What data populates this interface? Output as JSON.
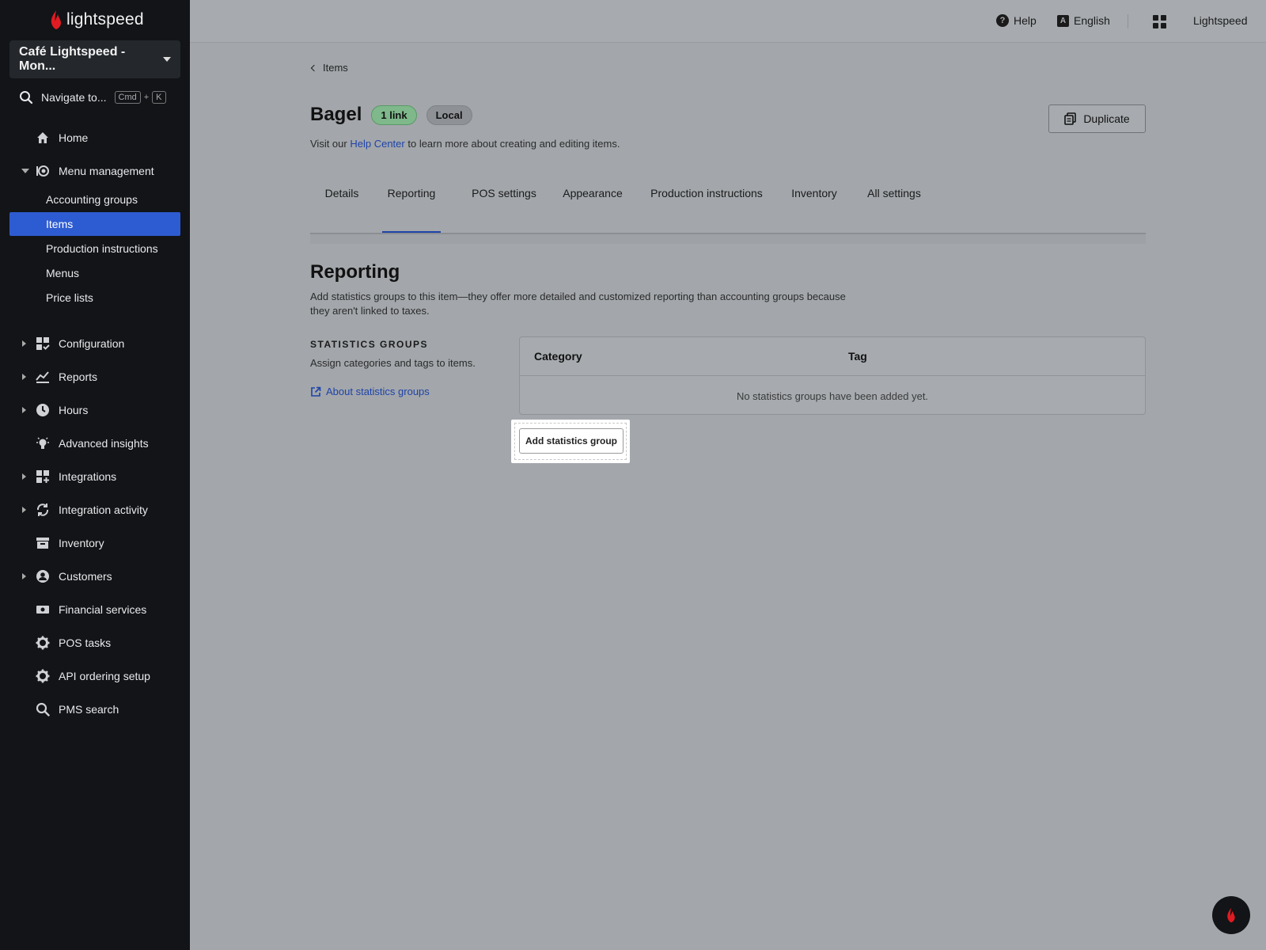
{
  "app": {
    "logo_text": "lightspeed",
    "location": "Café Lightspeed - Mon..."
  },
  "navigate": {
    "label": "Navigate to...",
    "key1": "Cmd",
    "plus": "+",
    "key2": "K"
  },
  "sidebar": {
    "home": "Home",
    "menu_management": "Menu management",
    "submenu": [
      "Accounting groups",
      "Items",
      "Production instructions",
      "Menus",
      "Price lists"
    ],
    "items": [
      {
        "label": "Configuration",
        "icon": "configuration-icon"
      },
      {
        "label": "Reports",
        "icon": "reports-icon"
      },
      {
        "label": "Hours",
        "icon": "clock-icon"
      },
      {
        "label": "Advanced insights",
        "icon": "lightbulb-icon"
      },
      {
        "label": "Integrations",
        "icon": "integrations-icon"
      },
      {
        "label": "Integration activity",
        "icon": "sync-icon"
      },
      {
        "label": "Inventory",
        "icon": "inventory-icon"
      },
      {
        "label": "Customers",
        "icon": "customer-icon"
      },
      {
        "label": "Financial services",
        "icon": "cash-icon"
      },
      {
        "label": "POS tasks",
        "icon": "gear-icon"
      },
      {
        "label": "API ordering setup",
        "icon": "gear-icon"
      },
      {
        "label": "PMS search",
        "icon": "search-icon"
      }
    ]
  },
  "topbar": {
    "help": "Help",
    "language_icon": "A",
    "language": "English",
    "account": "Lightspeed"
  },
  "page": {
    "breadcrumb": "Items",
    "title": "Bagel",
    "badge_link": "1 link",
    "badge_local": "Local",
    "help_prefix": "Visit our",
    "help_link": "Help Center",
    "help_suffix": "to learn more about creating and editing items.",
    "duplicate": "Duplicate"
  },
  "tabs": [
    "Details",
    "Reporting",
    "POS settings",
    "Appearance",
    "Production instructions",
    "Inventory",
    "All settings"
  ],
  "reporting": {
    "title": "Reporting",
    "description": "Add statistics groups to this item—they offer more detailed and customized reporting than accounting groups because they aren't linked to taxes.",
    "stat_heading": "STATISTICS GROUPS",
    "stat_sub": "Assign categories and tags to items.",
    "about_link": "About statistics groups",
    "table_headers": [
      "Category",
      "Tag"
    ],
    "empty_text": "No statistics groups have been added yet.",
    "add_button": "Add statistics group"
  },
  "colors": {
    "sidebar_bg": "#121417",
    "active_item": "#2d5bd1",
    "link": "#1f43a8",
    "brand_red": "#e11b22"
  }
}
